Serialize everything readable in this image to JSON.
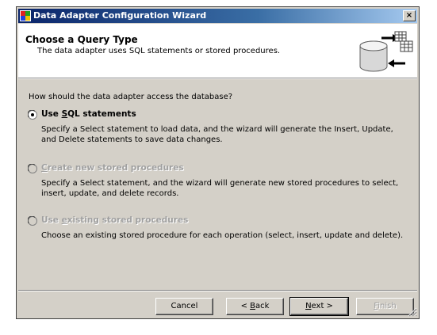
{
  "window": {
    "title": "Data Adapter Configuration Wizard",
    "close_label": "×"
  },
  "header": {
    "title": "Choose a Query Type",
    "subtitle": "The data adapter uses SQL statements or stored procedures."
  },
  "question": "How should the data adapter access the database?",
  "options": [
    {
      "label_pre": "Use ",
      "label_mnemonic": "S",
      "label_post": "QL statements",
      "selected": true,
      "enabled": true,
      "description": "Specify a Select statement to load data, and the wizard will generate the Insert, Update, and Delete statements to save data changes."
    },
    {
      "label_pre": "",
      "label_mnemonic": "C",
      "label_post": "reate new stored procedures",
      "selected": false,
      "enabled": false,
      "description": "Specify a Select statement, and the wizard will generate new stored procedures to select, insert, update, and delete records."
    },
    {
      "label_pre": "Use ",
      "label_mnemonic": "e",
      "label_post": "xisting stored procedures",
      "selected": false,
      "enabled": false,
      "description": "Choose an existing stored procedure for each operation (select, insert, update and delete)."
    }
  ],
  "buttons": {
    "cancel": {
      "label": "Cancel",
      "enabled": true
    },
    "back": {
      "label_pre": "< ",
      "label_mnemonic": "B",
      "label_post": "ack",
      "enabled": true
    },
    "next": {
      "label_pre": "",
      "label_mnemonic": "N",
      "label_post": "ext >",
      "enabled": true
    },
    "finish": {
      "label_pre": "",
      "label_mnemonic": "F",
      "label_post": "inish",
      "enabled": false
    }
  },
  "colors": {
    "titlebar_start": "#0a246a",
    "titlebar_end": "#a6caf0",
    "dialog_face": "#d4d0c8",
    "disabled_text": "#a0a0a0"
  },
  "icons": {
    "app": "wizard-app-icon",
    "header": "database-table-icon",
    "close": "close-icon"
  }
}
